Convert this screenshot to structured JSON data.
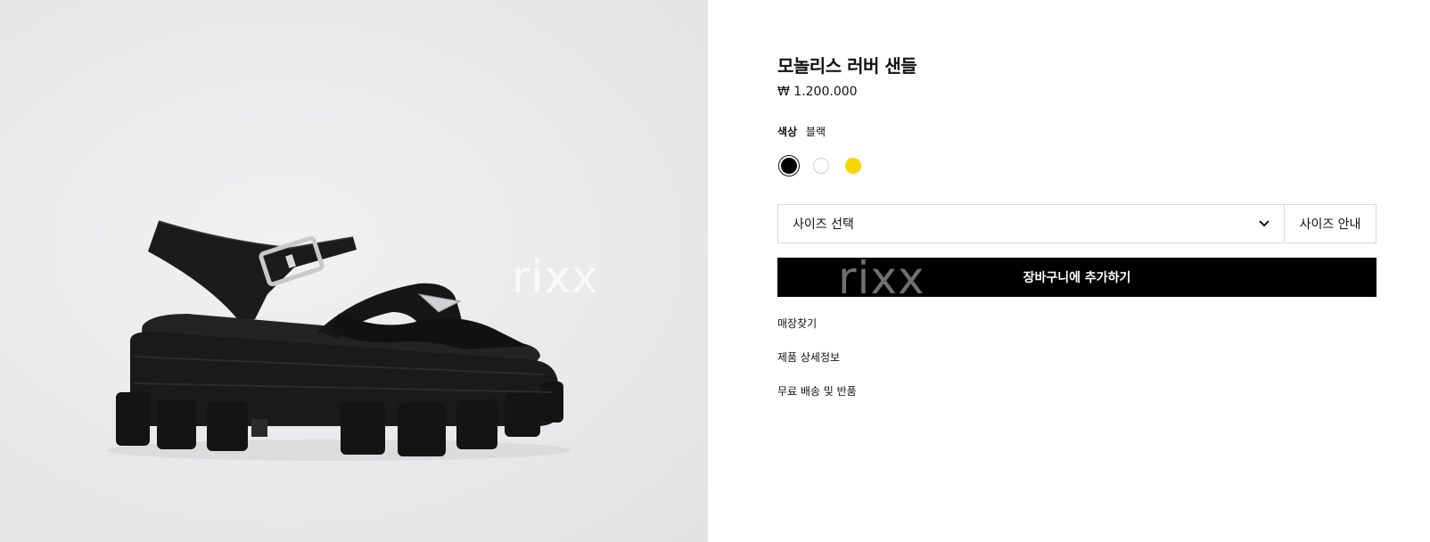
{
  "product": {
    "title": "모놀리스 러버 샌들",
    "price": "₩ 1.200.000"
  },
  "color": {
    "label": "색상",
    "selected": "블랙",
    "swatches": [
      {
        "name": "black",
        "hex": "#000000",
        "selected": true
      },
      {
        "name": "white",
        "hex": "#ffffff",
        "selected": false
      },
      {
        "name": "yellow",
        "hex": "#f7d600",
        "selected": false
      }
    ]
  },
  "size": {
    "select_label": "사이즈 선택",
    "guide_label": "사이즈 안내"
  },
  "cart": {
    "add_label": "장바구니에 추가하기"
  },
  "links": {
    "find_store": "매장찾기",
    "product_details": "제품 상세정보",
    "free_shipping": "무료 배송 및 반품"
  },
  "watermark": "rixx",
  "icons": {
    "size_dropdown": "chevron-down-icon"
  }
}
